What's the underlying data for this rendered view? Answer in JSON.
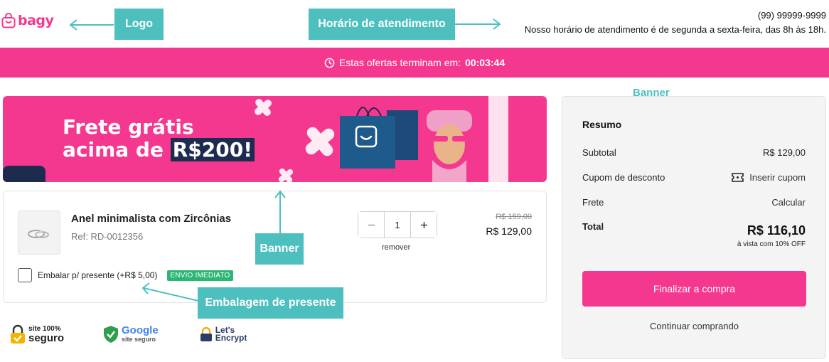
{
  "brand": {
    "logo_text": "bagy",
    "accent_color": "#f5388f",
    "annotation_color": "#4dbfbf",
    "badge_color": "#2bb673"
  },
  "header": {
    "phone": "(99) 99999-9999",
    "hours": "Nosso horário de atendimento é de segunda a sexta-feira, das 8h às 18h."
  },
  "countdown": {
    "icon": "clock-icon",
    "label": "Estas ofertas terminam em:",
    "time": "00:03:44"
  },
  "promo_banner": {
    "line1": "Frete grátis",
    "line2_prefix": "acima de ",
    "line2_highlight": "R$200!"
  },
  "cart_item": {
    "name": "Anel minimalista com Zircônias",
    "ref": "Ref: RD-0012356",
    "quantity": "1",
    "remove_label": "remover",
    "price_old": "R$ 159,00",
    "price_new": "R$ 129,00",
    "gift_label": "Embalar p/ presente (+R$ 5,00)",
    "gift_badge": "ENVIO IMEDIATO"
  },
  "seals": [
    {
      "icon": "lock-icon",
      "line1": "site 100%",
      "line2": "seguro"
    },
    {
      "icon": "shield-check-icon",
      "line1": "Google",
      "line2": "site seguro"
    },
    {
      "icon": "lets-encrypt-icon",
      "line1": "Let's",
      "line2": "Encrypt"
    }
  ],
  "summary": {
    "title": "Resumo",
    "subtotal_label": "Subtotal",
    "subtotal_value": "R$ 129,00",
    "coupon_label": "Cupom de desconto",
    "coupon_action": "Inserir cupom",
    "shipping_label": "Frete",
    "shipping_action": "Calcular",
    "total_label": "Total",
    "total_value": "R$ 116,10",
    "total_note": "à vista com 10% OFF",
    "checkout_button": "Finalizar a compra",
    "continue_link": "Continuar comprando"
  },
  "annotations": {
    "logo": "Logo",
    "hours": "Horário de atendimento",
    "banner_top": "Banner",
    "banner_mid": "Banner",
    "gift": "Embalagem de presente"
  }
}
